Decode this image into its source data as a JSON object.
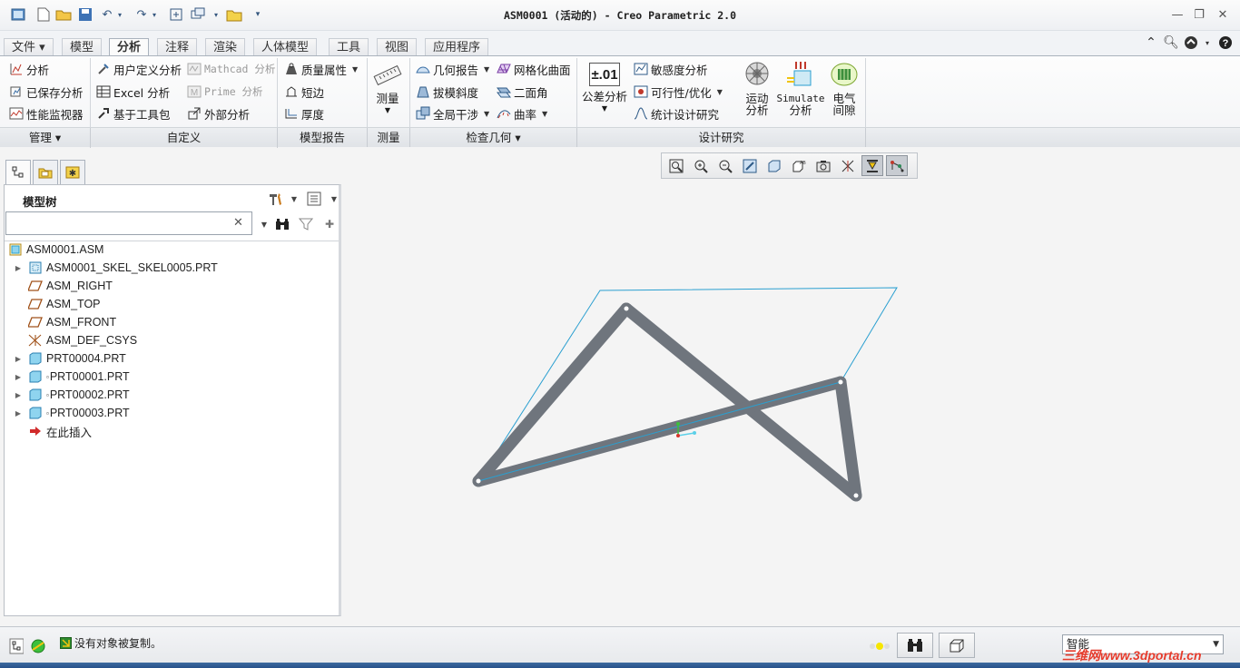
{
  "window": {
    "title": "ASM0001 (活动的) - Creo Parametric 2.0"
  },
  "tabs": [
    {
      "label": "文件 ▾",
      "active": false
    },
    {
      "label": "模型",
      "active": false
    },
    {
      "label": "分析",
      "active": true
    },
    {
      "label": "注释",
      "active": false
    },
    {
      "label": "渲染",
      "active": false
    },
    {
      "label": "人体模型",
      "active": false
    },
    {
      "label": "工具",
      "active": false
    },
    {
      "label": "视图",
      "active": false
    },
    {
      "label": "应用程序",
      "active": false
    }
  ],
  "ribbon": {
    "manage": {
      "analysis": "分析",
      "saved_analysis": "已保存分析",
      "performance_monitor": "性能监视器"
    },
    "custom": {
      "user_defined": "用户定义分析",
      "excel": "Excel 分析",
      "toolkit": "基于工具包",
      "mathcad": "Mathcad 分析",
      "prime": "Prime 分析",
      "external": "外部分析"
    },
    "model_report": {
      "mass_props": "质量属性",
      "short_edge": "短边",
      "thickness": "厚度"
    },
    "measure": {
      "label": "测量"
    },
    "inspect": {
      "geom_report": "几何报告",
      "draft": "拔模斜度",
      "global_interference": "全局干涉",
      "mesh_surface": "网格化曲面",
      "dihedral": "二面角",
      "curvature": "曲率"
    },
    "design_study": {
      "tolerance": "公差分析",
      "sensitivity": "敏感度分析",
      "feasibility": "可行性/优化",
      "statistical": "统计设计研究",
      "motion_line1": "运动",
      "motion_line2": "分析",
      "simulate_line1": "Simulate",
      "simulate_line2": "分析",
      "electrical_line1": "电气",
      "electrical_line2": "间隙",
      "tol_icon_text": "±.01"
    },
    "groups": {
      "manage": "管理 ▾",
      "custom": "自定义",
      "model_report": "模型报告",
      "measure": "测量",
      "inspect": "检查几何 ▾",
      "design_study": "设计研究"
    }
  },
  "model_tree": {
    "title": "模型树",
    "search_value": "",
    "items": [
      {
        "label": "ASM0001.ASM",
        "icon": "assembly-icon",
        "expandable": false
      },
      {
        "label": "ASM0001_SKEL_SKEL0005.PRT",
        "icon": "skeleton-icon",
        "expandable": true
      },
      {
        "label": "ASM_RIGHT",
        "icon": "datum-plane-icon",
        "expandable": false
      },
      {
        "label": "ASM_TOP",
        "icon": "datum-plane-icon",
        "expandable": false
      },
      {
        "label": "ASM_FRONT",
        "icon": "datum-plane-icon",
        "expandable": false
      },
      {
        "label": "ASM_DEF_CSYS",
        "icon": "csys-icon",
        "expandable": false
      },
      {
        "label": "PRT00004.PRT",
        "icon": "part-icon",
        "expandable": true
      },
      {
        "label": "PRT00001.PRT",
        "icon": "part-icon",
        "expandable": true
      },
      {
        "label": "PRT00002.PRT",
        "icon": "part-icon",
        "expandable": true
      },
      {
        "label": "PRT00003.PRT",
        "icon": "part-icon",
        "expandable": true
      },
      {
        "label": "在此插入",
        "icon": "insert-here-icon",
        "expandable": false
      }
    ]
  },
  "status": {
    "message": "没有对象被复制。",
    "filter": "智能"
  },
  "watermark": "三维网www.3dportal.cn",
  "colors": {
    "accent": "#3a6ea5",
    "link_body": "#6f757d",
    "skeleton_line": "#2a9fd0"
  }
}
